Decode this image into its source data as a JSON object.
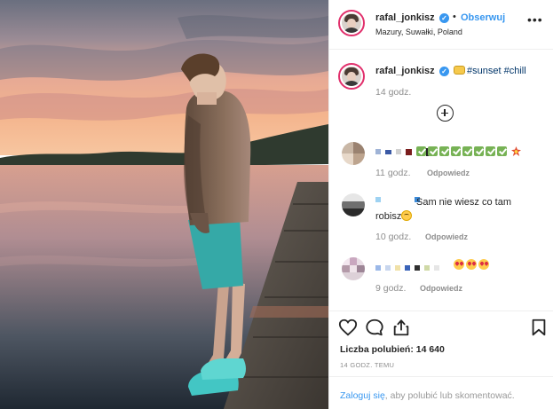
{
  "post": {
    "author": "rafal_jonkisz",
    "follow_label": "Obserwuj",
    "separator": "•",
    "location": "Mazury, Suwałki, Poland",
    "more_label": "•••",
    "caption_tags": "#sunset #chill",
    "caption_time": "14 godz.",
    "likes_label": "Liczba polubień: 14 640",
    "posted_label": "14 GODZ. TEMU",
    "login_link": "Zaloguj się",
    "login_rest": "aby polubić lub skomentować."
  },
  "comments": [
    {
      "time": "11 godz.",
      "reply": "Odpowiedz",
      "check_count": 8,
      "icon": "anger-burst-icon"
    },
    {
      "text_part1": "Sam nie wiesz co tam",
      "text_part2": "robisz",
      "time": "10 godz.",
      "reply": "Odpowiedz",
      "icon": "smiling-face-icon"
    },
    {
      "time": "9 godz.",
      "reply": "Odpowiedz",
      "emoji_count": 3,
      "icon": "heart-eyes-icon"
    }
  ],
  "icons": {
    "like": "heart-outline-icon",
    "comment": "comment-bubble-icon",
    "share": "share-icon",
    "save": "bookmark-icon",
    "load_more": "plus-circle-icon",
    "verified": "verified-badge-icon"
  },
  "colors": {
    "link": "#3897f0",
    "hashtag": "#003569",
    "muted": "#8e8e8e",
    "divider": "#efefef"
  }
}
